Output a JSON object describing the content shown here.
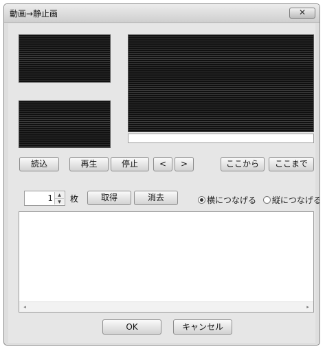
{
  "window": {
    "title": "動画→静止画",
    "close_label": "✕"
  },
  "buttons": {
    "load": "読込",
    "play": "再生",
    "stop": "停止",
    "prev": "<",
    "next": ">",
    "from_here": "ここから",
    "to_here": "ここまで",
    "acquire": "取得",
    "clear": "消去",
    "ok": "OK",
    "cancel": "キャンセル"
  },
  "frame_count": {
    "value": "1",
    "unit_label": "枚"
  },
  "join_mode": {
    "options": [
      {
        "label": "横につなげる",
        "checked": true
      },
      {
        "label": "縦につなげる",
        "checked": false
      }
    ]
  },
  "scrollbar": {
    "left_arrow": "◂",
    "right_arrow": "▸"
  }
}
